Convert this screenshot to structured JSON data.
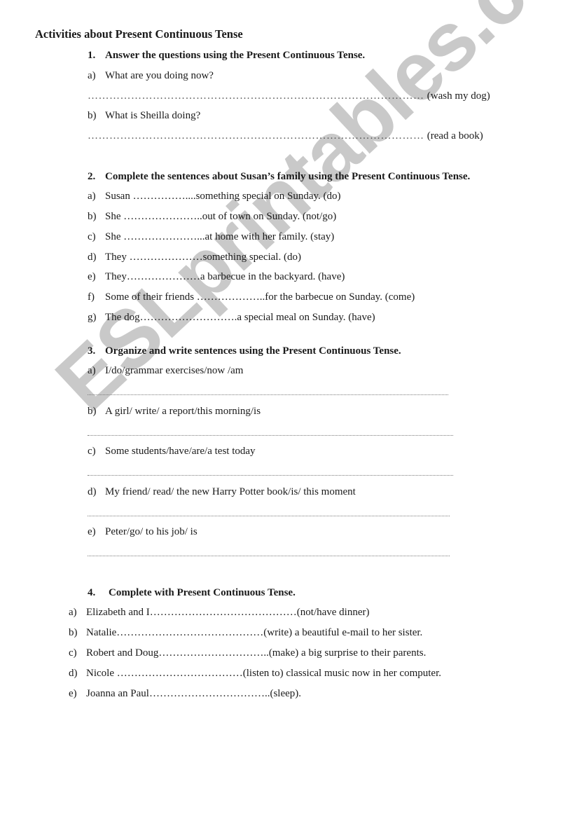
{
  "watermark": "ESLprintables.com",
  "title": "Activities about Present Continuous Tense",
  "sections": [
    {
      "number": "1.",
      "heading": "Answer the questions using the Present Continuous Tense.",
      "items": [
        {
          "label": "a)",
          "text": "What are you doing now?",
          "answer_dots": "…………………………………………………………………………………",
          "hint": "(wash my dog)"
        },
        {
          "label": "b)",
          "text": "What is Sheilla doing?",
          "answer_dots": "…………………………………………………………………………………",
          "hint": "(read a book)"
        }
      ]
    },
    {
      "number": "2.",
      "heading": "Complete the sentences about Susan’s family using the Present Continuous Tense.",
      "items": [
        {
          "label": "a)",
          "text": "Susan ……………....something special on Sunday. (do)"
        },
        {
          "label": "b)",
          "text": "She …………………..out of town on Sunday. (not/go)"
        },
        {
          "label": "c)",
          "text": "She …………………...at home with her family. (stay)"
        },
        {
          "label": "d)",
          "text": "They …………………something special. (do)"
        },
        {
          "label": "e)",
          "text": "They…………………a barbecue in the backyard. (have)"
        },
        {
          "label": "f)",
          "text": "Some of their friends ………………..for the barbecue on Sunday. (come)"
        },
        {
          "label": "g)",
          "text": "The dog……………………….a special meal on Sunday. (have)"
        }
      ]
    },
    {
      "number": "3.",
      "heading": "Organize and write sentences using the Present Continuous Tense.",
      "items": [
        {
          "label": "a)",
          "text": "I/do/grammar exercises/now /am"
        },
        {
          "label": "b)",
          "text": "A girl/ write/ a report/this morning/is"
        },
        {
          "label": "c)",
          "text": "Some students/have/are/a test today"
        },
        {
          "label": "d)",
          "text": "My friend/ read/ the new Harry Potter book/is/ this moment"
        },
        {
          "label": "e)",
          "text": "Peter/go/ to his job/ is"
        }
      ]
    },
    {
      "number": "4.",
      "heading": "Complete with Present Continuous Tense.",
      "items": [
        {
          "label": "a)",
          "text": "Elizabeth and I……………………………………(not/have dinner)"
        },
        {
          "label": "b)",
          "text": "Natalie……………………………………(write) a beautiful e-mail to her sister."
        },
        {
          "label": "c)",
          "text": "Robert and Doug…………………………..(make) a big surprise to their parents."
        },
        {
          "label": "d)",
          "text": "Nicole ………………………………(listen to) classical music now in her computer."
        },
        {
          "label": "e)",
          "text": "Joanna an Paul……………………………..(sleep)."
        }
      ]
    }
  ]
}
